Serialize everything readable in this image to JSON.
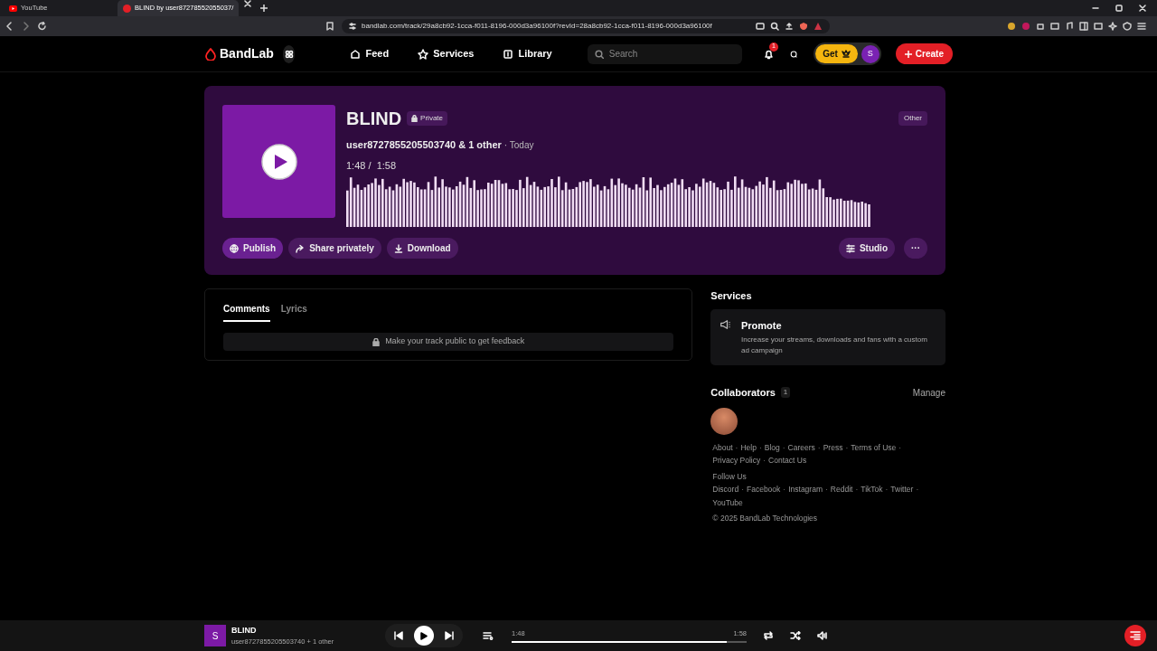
{
  "browser": {
    "tabs": [
      {
        "title": "YouTube",
        "selected": false
      },
      {
        "title": "BLIND by user87278552055037/",
        "selected": true
      }
    ],
    "url": "bandlab.com/track/29a8cb92-1cca-f011-8196-000d3a96100f?revId=28a8cb92-1cca-f011-8196-000d3a96100f"
  },
  "nav": {
    "logo": "BandLab",
    "links": [
      {
        "label": "Feed"
      },
      {
        "label": "Services"
      },
      {
        "label": "Library"
      }
    ],
    "search": {
      "placeholder": "Search"
    },
    "notifications": "1",
    "get": "Get",
    "avatar": "S",
    "create": "Create"
  },
  "track": {
    "title": "BLIND",
    "privacy": "Private",
    "credits": "user8727855205503740 & 1 other",
    "date": "· Today",
    "time": "1:48 /  1:58",
    "genre": "Other",
    "actions": [
      {
        "label": "Publish",
        "kind": "publish"
      },
      {
        "label": "Share privately",
        "kind": "share"
      },
      {
        "label": "Download",
        "kind": "download"
      }
    ],
    "studio": "Studio",
    "more": "···"
  },
  "tabs": [
    {
      "label": "Comments",
      "selected": true
    },
    {
      "label": "Lyrics",
      "selected": false
    }
  ],
  "notice": "Make your track public to get feedback",
  "services": {
    "heading": "Services",
    "items": [
      {
        "title": "Promote",
        "description": "Increase your streams, downloads and fans with a custom ad campaign"
      }
    ]
  },
  "collaborators": {
    "heading": "Collaborators",
    "count": "1",
    "manage": "Manage"
  },
  "footer": {
    "separator": "·",
    "links": [
      "About",
      "Help",
      "Blog",
      "Careers",
      "Press",
      "Terms of Use",
      "Privacy Policy",
      "Contact Us"
    ],
    "follow": "Follow Us",
    "social": [
      "Discord",
      "Facebook",
      "Instagram",
      "Reddit",
      "TikTok",
      "Twitter",
      "YouTube"
    ],
    "copyright": "© 2025 BandLab Technologies"
  },
  "player": {
    "cover": "S",
    "title": "BLIND",
    "subtitle": "user8727855205503740 + 1 other",
    "current": "1:48",
    "total": "1:58",
    "level": 0.915
  }
}
